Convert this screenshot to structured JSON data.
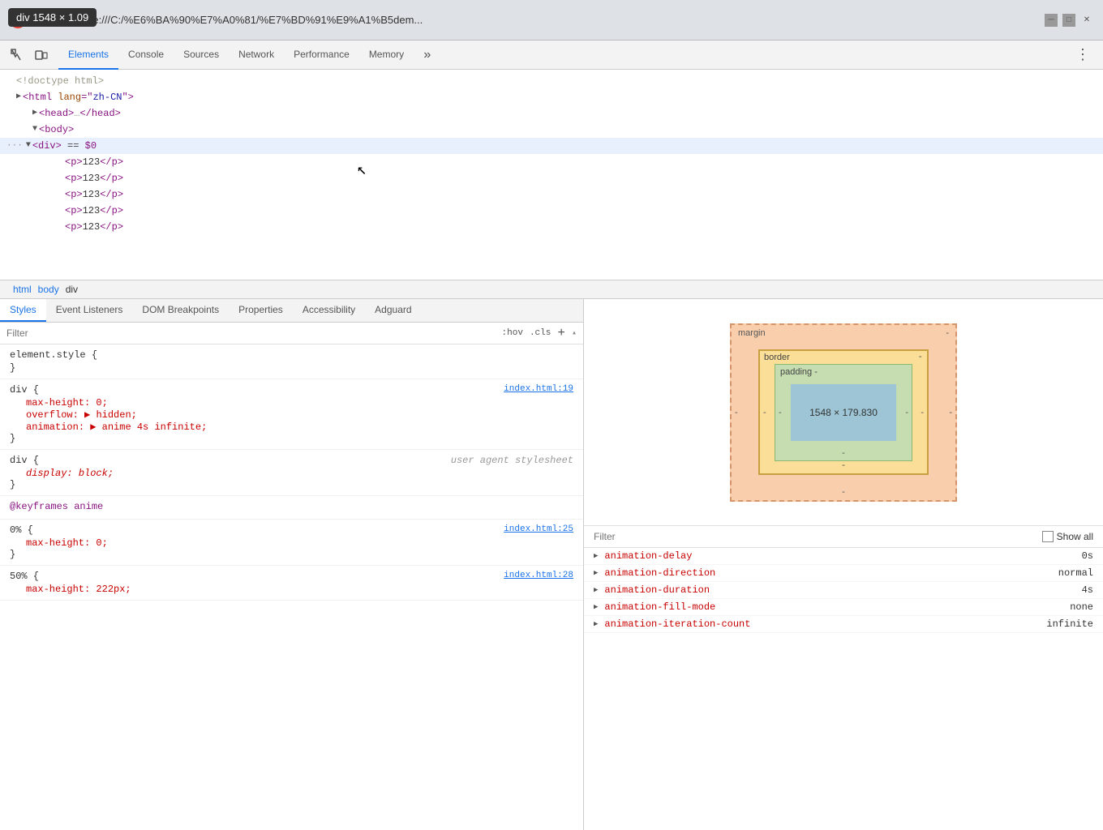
{
  "tooltip": {
    "text": "div  1548 × 1.09"
  },
  "browser": {
    "icon": "chrome-icon",
    "title": "DevTools - file:///C:/%E6%BA%90%E7%A0%81/%E7%BD%91%E9%A1%B5dem...",
    "minimize": "─",
    "maximize": "□",
    "close": "✕"
  },
  "top_tabs": {
    "icons": [
      {
        "name": "cursor-icon",
        "symbol": "⬚"
      },
      {
        "name": "device-icon",
        "symbol": "⬕"
      }
    ],
    "tabs": [
      {
        "label": "Elements",
        "active": true
      },
      {
        "label": "Console",
        "active": false
      },
      {
        "label": "Sources",
        "active": false
      },
      {
        "label": "Network",
        "active": false
      },
      {
        "label": "Performance",
        "active": false
      },
      {
        "label": "Memory",
        "active": false
      }
    ],
    "more": "»",
    "menu": "⋮"
  },
  "dom": {
    "lines": [
      {
        "text": "<!doctype html>",
        "type": "comment",
        "indent": 0
      },
      {
        "text": "<html lang=\"zh-CN\">",
        "type": "tag",
        "indent": 0,
        "triangle": "▶"
      },
      {
        "text": "<head>…</head>",
        "type": "tag",
        "indent": 1,
        "triangle": "▶"
      },
      {
        "text": "<body>",
        "type": "tag",
        "indent": 1,
        "triangle": "▼"
      },
      {
        "text": "<div> == $0",
        "type": "selected",
        "indent": 2,
        "triangle": "▼",
        "ellipsis": "···"
      },
      {
        "text": "<p>123</p>",
        "type": "tag",
        "indent": 3
      },
      {
        "text": "<p>123</p>",
        "type": "tag",
        "indent": 3
      },
      {
        "text": "<p>123</p>",
        "type": "tag",
        "indent": 3
      },
      {
        "text": "<p>123</p>",
        "type": "tag",
        "indent": 3
      },
      {
        "text": "<p>123</p>",
        "type": "tag",
        "indent": 3
      }
    ]
  },
  "breadcrumb": {
    "items": [
      "html",
      "body",
      "div"
    ]
  },
  "styles_tabs": {
    "tabs": [
      {
        "label": "Styles",
        "active": true
      },
      {
        "label": "Event Listeners",
        "active": false
      },
      {
        "label": "DOM Breakpoints",
        "active": false
      },
      {
        "label": "Properties",
        "active": false
      },
      {
        "label": "Accessibility",
        "active": false
      },
      {
        "label": "Adguard",
        "active": false
      }
    ]
  },
  "filter": {
    "placeholder": "Filter",
    "hov": ":hov",
    "cls": ".cls",
    "add": "+",
    "arrow": "▴"
  },
  "css_blocks": [
    {
      "selector": "element.style {",
      "source": "",
      "properties": [
        {
          "prop": "}",
          "val": "",
          "type": "brace"
        }
      ]
    },
    {
      "selector": "div {",
      "source": "index.html:19",
      "properties": [
        {
          "prop": "max-height",
          "val": "0;",
          "type": "red"
        },
        {
          "prop": "overflow",
          "val": "▶ hidden;",
          "type": "red"
        },
        {
          "prop": "animation",
          "val": "▶ anime 4s infinite;",
          "type": "red"
        }
      ]
    },
    {
      "selector": "div {",
      "source": "user agent stylesheet",
      "properties": [
        {
          "prop": "display",
          "val": "block;",
          "type": "italic-red"
        }
      ]
    },
    {
      "selector": "@keyframes anime",
      "source": "",
      "properties": []
    },
    {
      "selector": "0% {",
      "source": "index.html:25",
      "properties": [
        {
          "prop": "max-height",
          "val": "0;",
          "type": "red"
        }
      ]
    },
    {
      "selector": "50% {",
      "source": "index.html:28",
      "properties": [
        {
          "prop": "max-height",
          "val": "222px;",
          "type": "red"
        }
      ]
    }
  ],
  "box_model": {
    "margin_label": "margin",
    "border_label": "border",
    "padding_label": "padding -",
    "content": "1548 × 179.830",
    "margin_dash": "-",
    "border_dash": "-",
    "padding_top_dash": "-",
    "padding_bottom_dash": "-",
    "margin_left_dash": "-",
    "margin_right_dash": "-",
    "border_left_dash": "-",
    "border_right_dash": "-"
  },
  "computed_filter": {
    "placeholder": "Filter",
    "show_all": "Show all"
  },
  "computed_props": [
    {
      "name": "animation-delay",
      "value": "0s"
    },
    {
      "name": "animation-direction",
      "value": "normal"
    },
    {
      "name": "animation-duration",
      "value": "4s"
    },
    {
      "name": "animation-fill-mode",
      "value": "none"
    },
    {
      "name": "animation-iteration-count",
      "value": "infinite"
    }
  ]
}
